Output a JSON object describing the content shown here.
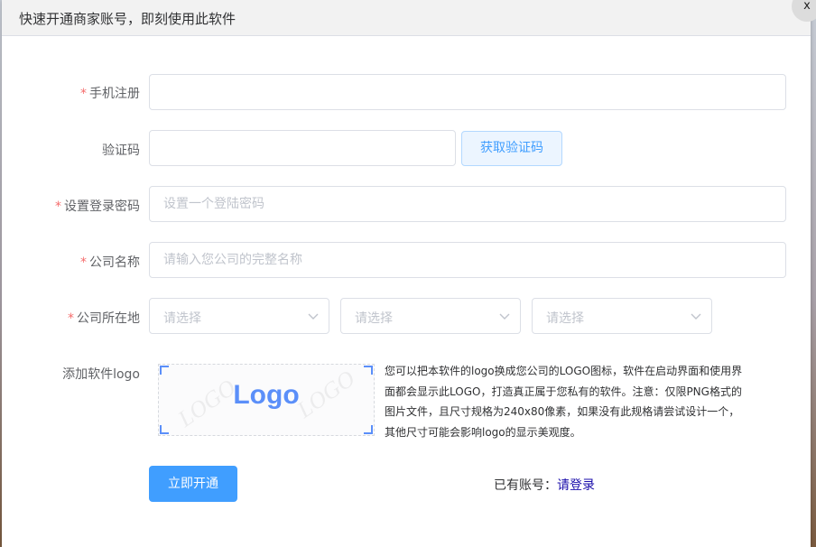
{
  "dialog": {
    "title": "快速开通商家账号，即刻使用此软件",
    "close_label": "x"
  },
  "form": {
    "required_mark": "*",
    "phone": {
      "label": "手机注册",
      "value": "",
      "placeholder": ""
    },
    "code": {
      "label": "验证码",
      "value": "",
      "placeholder": "",
      "button_label": "获取验证码"
    },
    "password": {
      "label": "设置登录密码",
      "value": "",
      "placeholder": "设置一个登陆密码"
    },
    "company": {
      "label": "公司名称",
      "value": "",
      "placeholder": "请输入您公司的完整名称"
    },
    "location": {
      "label": "公司所在地",
      "selects": [
        {
          "placeholder": "请选择"
        },
        {
          "placeholder": "请选择"
        },
        {
          "placeholder": "请选择"
        }
      ]
    },
    "logo": {
      "label": "添加软件logo",
      "preview_text": "Logo",
      "watermark": "LOGO",
      "description": "您可以把本软件的logo换成您公司的LOGO图标，软件在启动界面和使用界面都会显示此LOGO，打造真正属于您私有的软件。注意：仅限PNG格式的图片文件，且尺寸规格为240x80像素，如果没有此规格请尝试设计一个，其他尺寸可能会影响logo的显示美观度。"
    },
    "submit_label": "立即开通",
    "login_prompt": "已有账号：",
    "login_link": "请登录"
  },
  "colors": {
    "primary": "#409eff",
    "required": "#f56c6c",
    "logo_blue": "#5b8ff9",
    "link": "#1a0dab"
  }
}
